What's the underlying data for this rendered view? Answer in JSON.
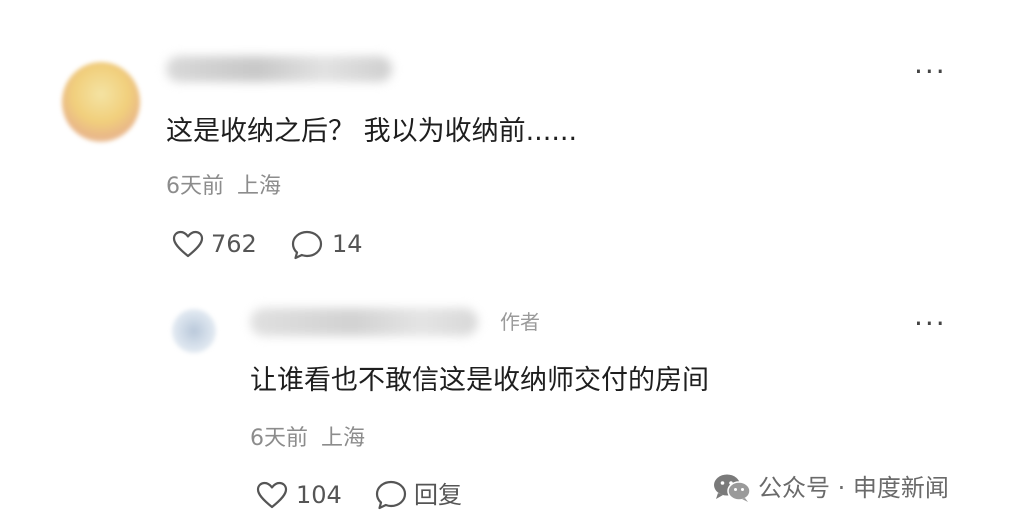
{
  "comment": {
    "text": "这是收纳之后？ 我以为收纳前......",
    "time": "6天前",
    "location": "上海",
    "likes": "762",
    "replies": "14",
    "more": "···"
  },
  "reply": {
    "author_tag": "作者",
    "text": "让谁看也不敢信这是收纳师交付的房间",
    "time": "6天前",
    "location": "上海",
    "likes": "104",
    "reply_label": "回复",
    "more": "···"
  },
  "watermark": {
    "text": "公众号 · 申度新闻",
    "icon": "wechat-icon"
  }
}
